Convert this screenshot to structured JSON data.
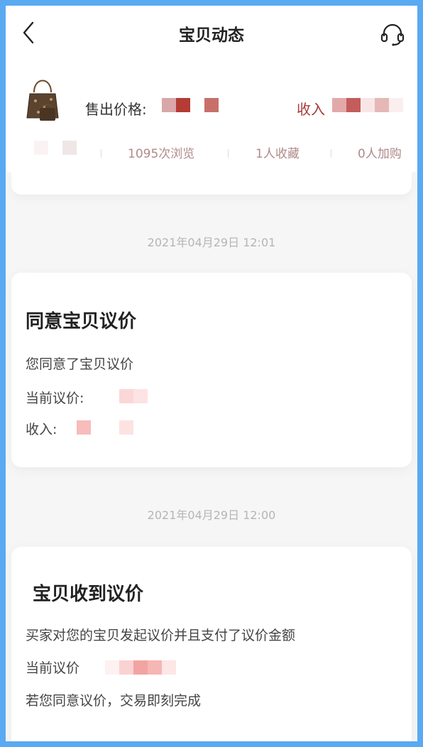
{
  "navbar": {
    "title": "宝贝动态",
    "back_icon": "chevron-left-icon",
    "service_icon": "headset-icon"
  },
  "product": {
    "price_label": "售出价格:",
    "income_label": "收入",
    "stats": {
      "views": "1095次浏览",
      "favorites": "1人收藏",
      "cart": "0人加购"
    }
  },
  "events": [
    {
      "timestamp": "2021年04月29日 12:01",
      "title": "同意宝贝议价",
      "description": "您同意了宝贝议价",
      "current_price_label": "当前议价:",
      "income_label": "收入:"
    },
    {
      "timestamp": "2021年04月29日 12:00",
      "title": "宝贝收到议价",
      "description": "买家对您的宝贝发起议价并且支付了议价金额",
      "current_price_label": "当前议价",
      "note": "若您同意议价，交易即刻完成"
    }
  ],
  "colors": {
    "frame": "#59aaf2",
    "background": "#f6f6f7",
    "income": "#a93a3a",
    "stats": "#b08a8a"
  }
}
